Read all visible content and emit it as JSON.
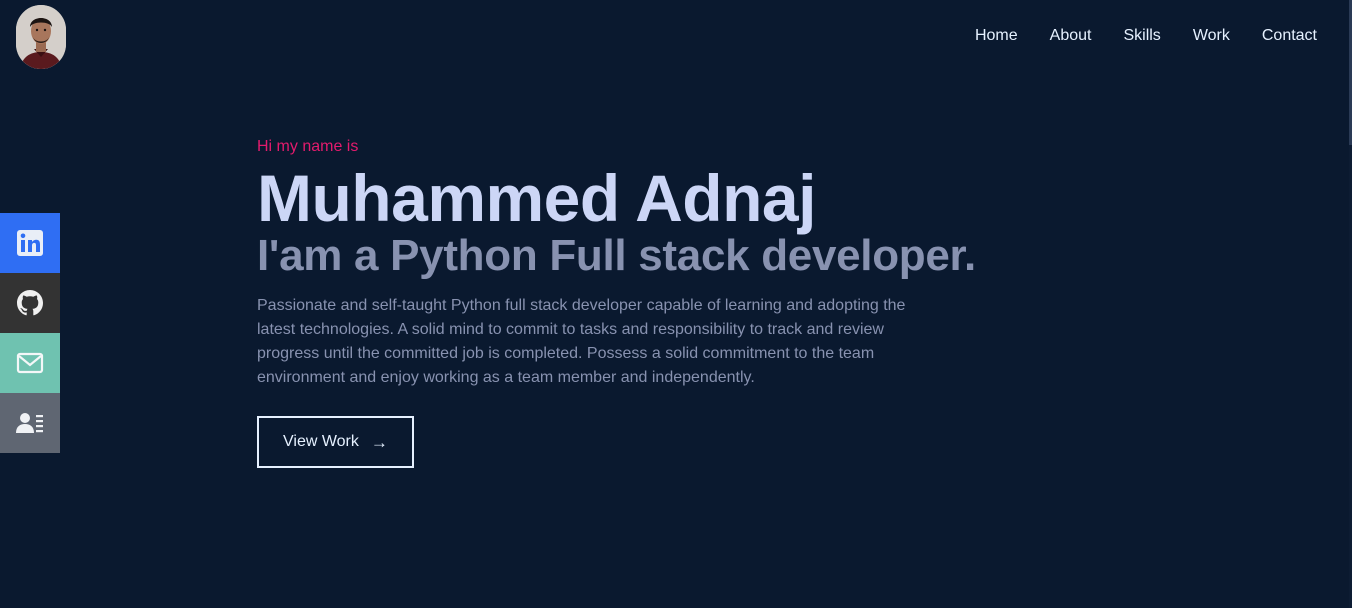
{
  "profile": {
    "avatar_icon": "avatar-photo"
  },
  "nav": {
    "items": [
      {
        "label": "Home"
      },
      {
        "label": "About"
      },
      {
        "label": "Skills"
      },
      {
        "label": "Work"
      },
      {
        "label": "Contact"
      }
    ]
  },
  "social": [
    {
      "name": "linkedin-icon",
      "color": "#2f6ef3"
    },
    {
      "name": "github-icon",
      "color": "#333333"
    },
    {
      "name": "mail-icon",
      "color": "#6fc2b0"
    },
    {
      "name": "resume-icon",
      "color": "#5f6672"
    }
  ],
  "hero": {
    "greeting": "Hi my name is",
    "name": "Muhammed Adnaj",
    "tagline": "I'am a Python Full stack developer.",
    "bio": "Passionate and self-taught Python full stack developer capable of learning and adopting the latest technologies. A solid mind to commit to tasks and responsibility to track and review progress until the committed job is completed. Possess a solid commitment to the team environment and enjoy working as a team member and independently.",
    "button_label": "View Work",
    "button_arrow": "→"
  },
  "colors": {
    "background": "#0a192f",
    "accent": "#e31b6d",
    "heading": "#ccd6f6",
    "muted": "#8892b0"
  }
}
